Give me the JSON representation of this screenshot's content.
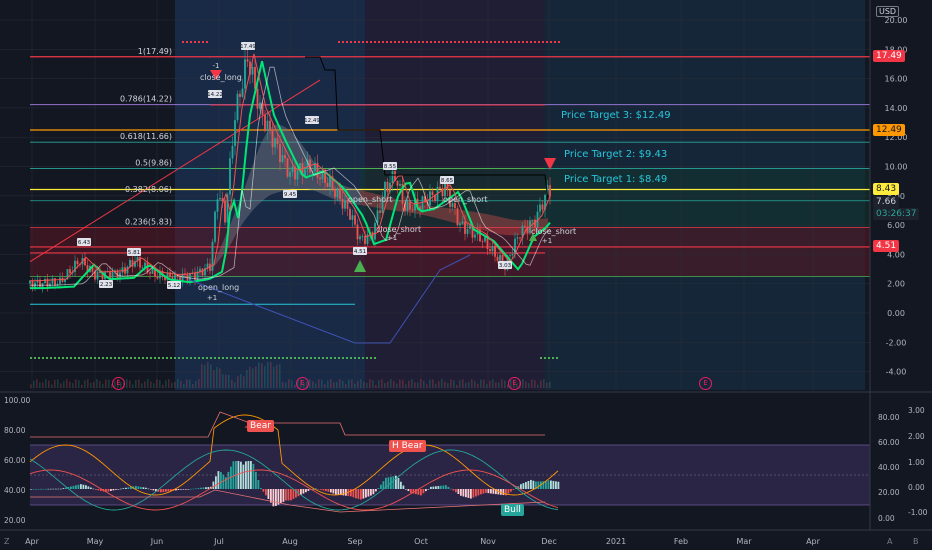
{
  "currency": "USD",
  "price_axis": {
    "ticks": [
      "20.00",
      "18.00",
      "16.00",
      "14.00",
      "12.00",
      "10.00",
      "8.00",
      "6.00",
      "4.00",
      "2.00",
      "0.00",
      "-2.00",
      "-4.00"
    ]
  },
  "osc_axis_left": {
    "ticks": [
      "100.00",
      "80.00",
      "60.00",
      "40.00",
      "20.00"
    ]
  },
  "osc_axis_mid": {
    "ticks": [
      "80.00",
      "60.00",
      "40.00",
      "20.00",
      "0.00"
    ]
  },
  "osc_axis_right": {
    "ticks": [
      "3.00",
      "2.00",
      "1.00",
      "0.00",
      "-1.00"
    ]
  },
  "time_axis": {
    "labels": [
      "Apr",
      "May",
      "Jun",
      "Jul",
      "Aug",
      "Sep",
      "Oct",
      "Nov",
      "Dec",
      "2021",
      "Feb",
      "Mar",
      "Apr"
    ]
  },
  "fib_labels": [
    "1(17.49)",
    "0.786(14.22)",
    "0.618(11.66)",
    "0.5(9.86)",
    "0.382(8.06)",
    "0.236(5.83)"
  ],
  "targets": {
    "t3": "Price Target 3: $12.49",
    "t2": "Price Target 2: $9.43",
    "t1": "Price Target 1: $8.49"
  },
  "price_badges": {
    "b1749": "17.49",
    "b1249": "12.49",
    "b843": "8.43",
    "b766": "7.66",
    "bcountdown": "03:26:37",
    "b451": "4.51"
  },
  "signals": {
    "close_long": "close_long",
    "open_long": "open_long",
    "plus1_a": "+1",
    "minus1_a": "-1",
    "open_short_1": "open_short",
    "close_short_1": "close_short",
    "plus1_b": "+1",
    "open_short_2": "open_short",
    "close_short_2": "close_short",
    "plus1_c": "+1"
  },
  "pivot_labels": {
    "p1": "17.49",
    "p2": "14.22",
    "p3": "12.49",
    "p4": "8.55",
    "p5": "8.65",
    "p6": "4.51",
    "p7": "9.45",
    "p8": "6.43",
    "p9": "5.81",
    "p10": "3.03",
    "p11": "2.23",
    "p12": "5.12"
  },
  "osc_badges": {
    "bear": "Bear",
    "hbear": "H Bear",
    "bull": "Bull"
  },
  "events": [
    "E",
    "E",
    "E",
    "E"
  ],
  "bottom_left": "Z",
  "bottom_right": [
    "A",
    "B"
  ],
  "colors": {
    "background": "#131722",
    "up": "#26a69a",
    "down": "#ef5350",
    "target": "#26c6da",
    "fib_red": "#f23645",
    "fib_orange": "#ff9800",
    "fib_yellow": "#ffeb3b",
    "signal_green": "#4caf50"
  },
  "chart_data": {
    "type": "line",
    "title": "",
    "x": [
      "Apr",
      "May",
      "Jun",
      "Jul",
      "Aug",
      "Sep",
      "Oct",
      "Nov",
      "Dec"
    ],
    "series": [
      {
        "values": [
          2.0,
          3.6,
          2.6,
          12.0,
          10.5,
          5.0,
          8.0,
          4.5,
          8.43
        ]
      }
    ],
    "ylim": [
      -4,
      20
    ],
    "horizontal_levels": [
      17.49,
      14.22,
      12.49,
      11.66,
      9.86,
      9.43,
      8.49,
      8.06,
      5.83,
      4.51
    ],
    "oscillator": {
      "ylim": [
        20,
        100
      ],
      "bands": [
        30,
        70
      ],
      "histogram_range": [
        -1,
        3
      ]
    },
    "legend": "none",
    "grid": true
  }
}
